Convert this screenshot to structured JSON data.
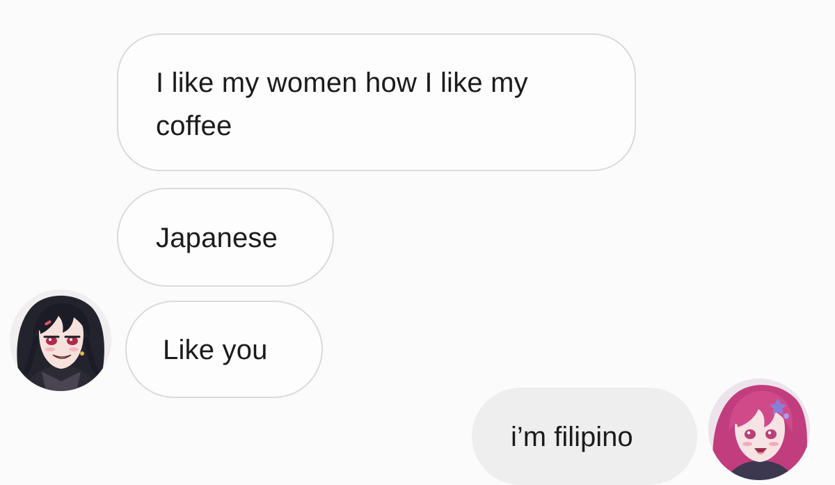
{
  "messages": {
    "incoming": [
      {
        "text": "I like my women how I like my coffee"
      },
      {
        "text": "Japanese"
      },
      {
        "text": "Like you"
      }
    ],
    "outgoing": [
      {
        "text": "i’m filipino"
      }
    ]
  },
  "avatars": {
    "left": {
      "icon": "anime-avatar-dark-hair-icon"
    },
    "right": {
      "icon": "anime-avatar-pink-hair-icon"
    }
  },
  "colors": {
    "background": "#fbfbfb",
    "incoming_bubble_border": "#dadada",
    "outgoing_bubble_fill": "#eeeeee",
    "text": "#1b1b1b"
  }
}
